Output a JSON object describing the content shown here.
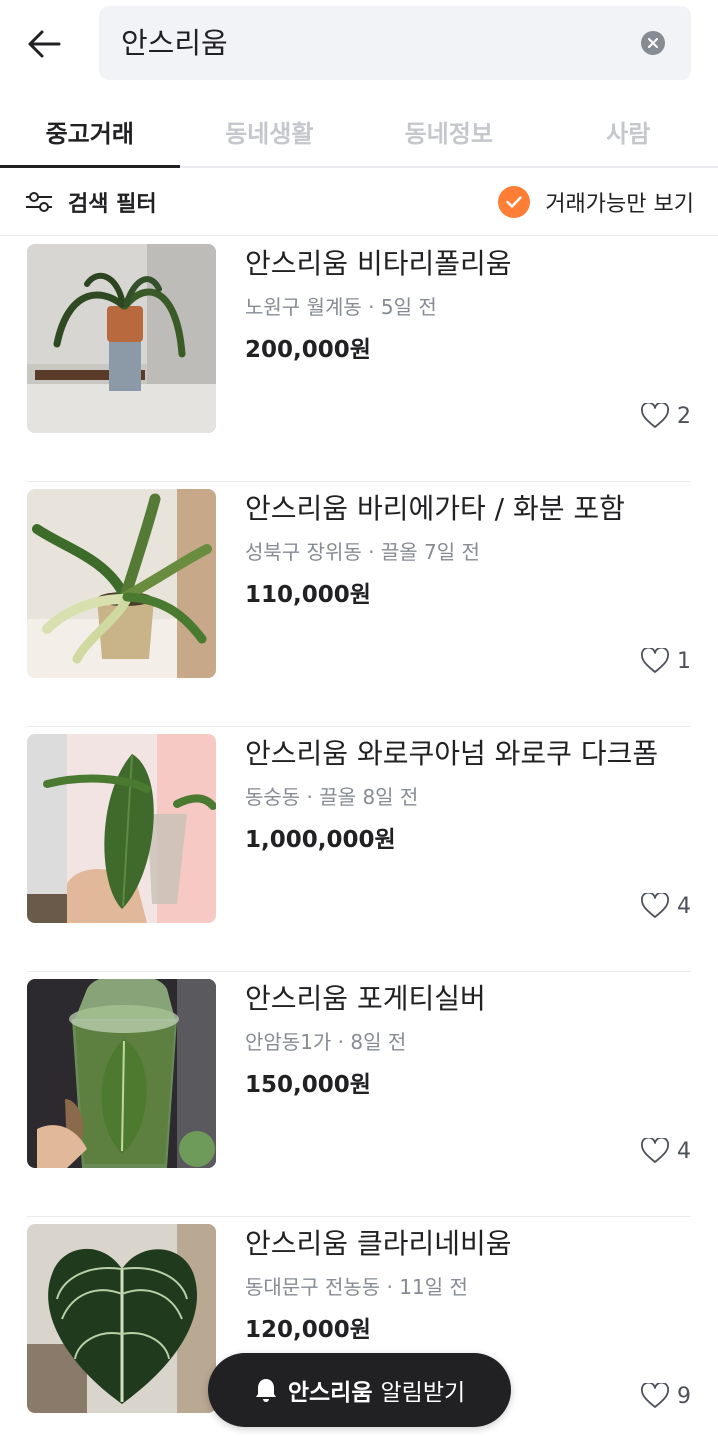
{
  "search": {
    "query": "안스리움"
  },
  "tabs": [
    {
      "label": "중고거래",
      "active": true
    },
    {
      "label": "동네생활",
      "active": false
    },
    {
      "label": "동네정보",
      "active": false
    },
    {
      "label": "사람",
      "active": false
    }
  ],
  "filter": {
    "label": "검색 필터",
    "available_only_label": "거래가능만 보기",
    "available_only_checked": true
  },
  "colors": {
    "accent": "#ff7e36",
    "text": "#212124",
    "muted": "#868b94"
  },
  "items": [
    {
      "title": "안스리움 비타리폴리움",
      "location": "노원구 월계동",
      "time": "5일 전",
      "price": "200,000원",
      "likes": "2"
    },
    {
      "title": "안스리움 바리에가타 / 화분 포함",
      "location": "성북구 장위동",
      "time": "끌올 7일 전",
      "price": "110,000원",
      "likes": "1"
    },
    {
      "title": "안스리움 와로쿠아넘 와로쿠 다크폼",
      "location": "동숭동",
      "time": "끌올 8일 전",
      "price": "1,000,000원",
      "likes": "4"
    },
    {
      "title": "안스리움 포게티실버",
      "location": "안암동1가",
      "time": "8일 전",
      "price": "150,000원",
      "likes": "4"
    },
    {
      "title": "안스리움 클라리네비움",
      "location": "동대문구 전농동",
      "time": "11일 전",
      "price": "120,000원",
      "likes": "9"
    }
  ],
  "alarm": {
    "keyword": "안스리움",
    "label": "알림받기"
  },
  "icons": {
    "back": "arrow-left-icon",
    "clear": "close-icon",
    "filter": "sliders-icon",
    "check": "check-icon",
    "like": "heart-icon",
    "bell": "bell-icon"
  }
}
